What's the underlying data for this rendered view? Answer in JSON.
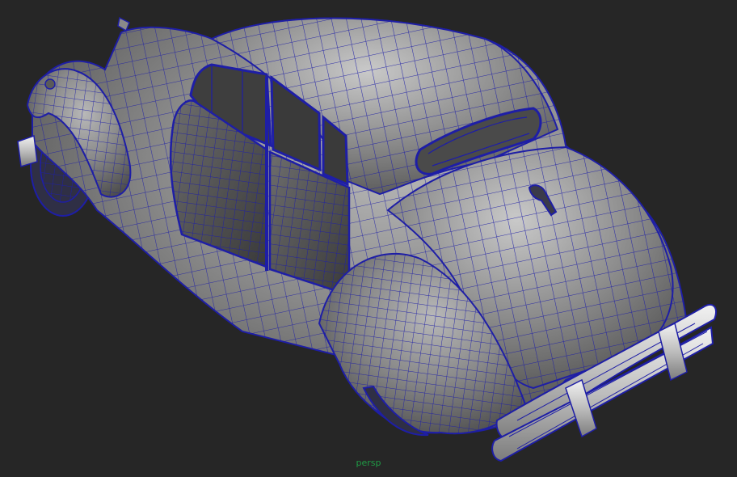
{
  "viewport": {
    "camera_label": "persp",
    "background_color": "#262626",
    "wireframe_color": "#1a1aa0",
    "shaded_color": "#8d8d8d",
    "label_color": "#1f9a45",
    "object": "vintage-sedan-model"
  }
}
